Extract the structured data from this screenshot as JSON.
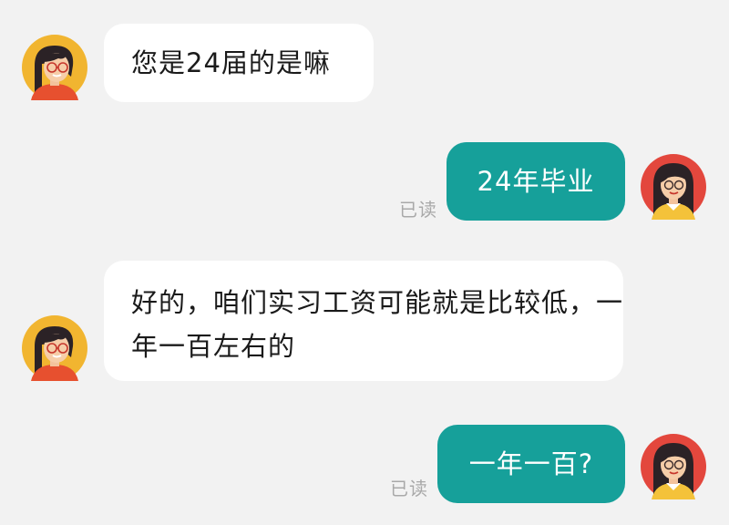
{
  "conversation": {
    "messages": [
      {
        "sender": "other",
        "text": "您是24届的是嘛"
      },
      {
        "sender": "me",
        "text": "24年毕业",
        "status": "已读"
      },
      {
        "sender": "other",
        "text": "好的，咱们实习工资可能就是比较低，一年一百左右的"
      },
      {
        "sender": "me",
        "text": "一年一百?",
        "status": "已读"
      }
    ]
  },
  "avatars": {
    "other": {
      "icon": "woman-with-glasses-avatar-icon",
      "background": "#f1b530"
    },
    "me": {
      "icon": "woman-avatar-icon",
      "background": "#e3473d"
    }
  },
  "colors": {
    "background": "#f2f2f2",
    "incoming_bubble": "#ffffff",
    "outgoing_bubble": "#16a09a",
    "read_status": "#a9a9a9"
  }
}
